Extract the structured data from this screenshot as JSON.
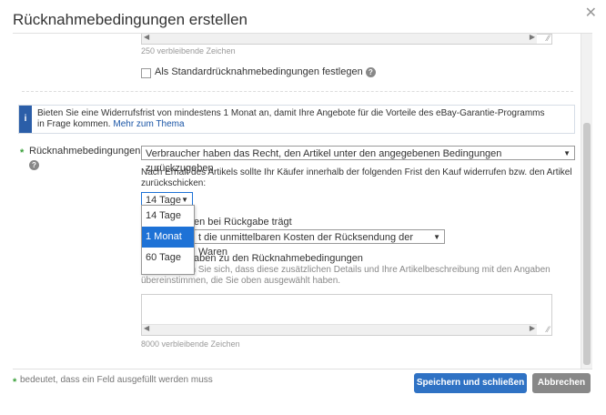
{
  "dialog": {
    "title": "Rücknahmebedingungen erstellen",
    "close_icon": "close-icon"
  },
  "top_section": {
    "remaining_chars": "250 verbleibende Zeichen",
    "checkbox_label": "Als Standardrücknahmebedingungen festlegen",
    "checkbox_checked": false
  },
  "info": {
    "text": "Bieten Sie eine Widerrufsfrist von mindestens 1 Monat an, damit Ihre Angebote für die Vorteile des eBay-Garantie-Programms in Frage kommen.",
    "link": "Mehr zum Thema"
  },
  "return_policy": {
    "label": "Rücknahmebedingungen",
    "selected": "Verbraucher haben das Recht, den Artikel unter den angegebenen Bedingungen zurückzugeben.",
    "period_text": "Nach Erhalt des Artikels sollte Ihr Käufer innerhalb der folgenden Frist den Kauf widerrufen bzw. den Artikel zurückschicken:",
    "period_selected": "14 Tage",
    "period_options": [
      "14 Tage",
      "1 Monat",
      "60 Tage"
    ],
    "period_highlighted": "1 Monat",
    "cost_label_partial": "en bei Rückgabe trägt",
    "cost_selected_partial": "t die unmittelbaren Kosten der Rücksendung der Waren",
    "details_label_partial": "aben zu den Rücknahmebedingungen",
    "details_note_partial": "Vergewissern Sie sich, dass diese zusätzlichen Details und Ihre Artikelbeschreibung mit den Angaben übereinstimmen, die Sie oben ausgewählt haben.",
    "details_remaining": "8000 verbleibende Zeichen"
  },
  "footer": {
    "required_note": "bedeutet, dass ein Feld ausgefüllt werden muss",
    "save_button": "Speichern und schließen",
    "cancel_button": "Abbrechen"
  },
  "colors": {
    "primary_button": "#2f72c4",
    "secondary_button": "#888888",
    "info_icon": "#2b5ea8",
    "required_star": "#3aa03a",
    "selected_option": "#1e72d6"
  }
}
